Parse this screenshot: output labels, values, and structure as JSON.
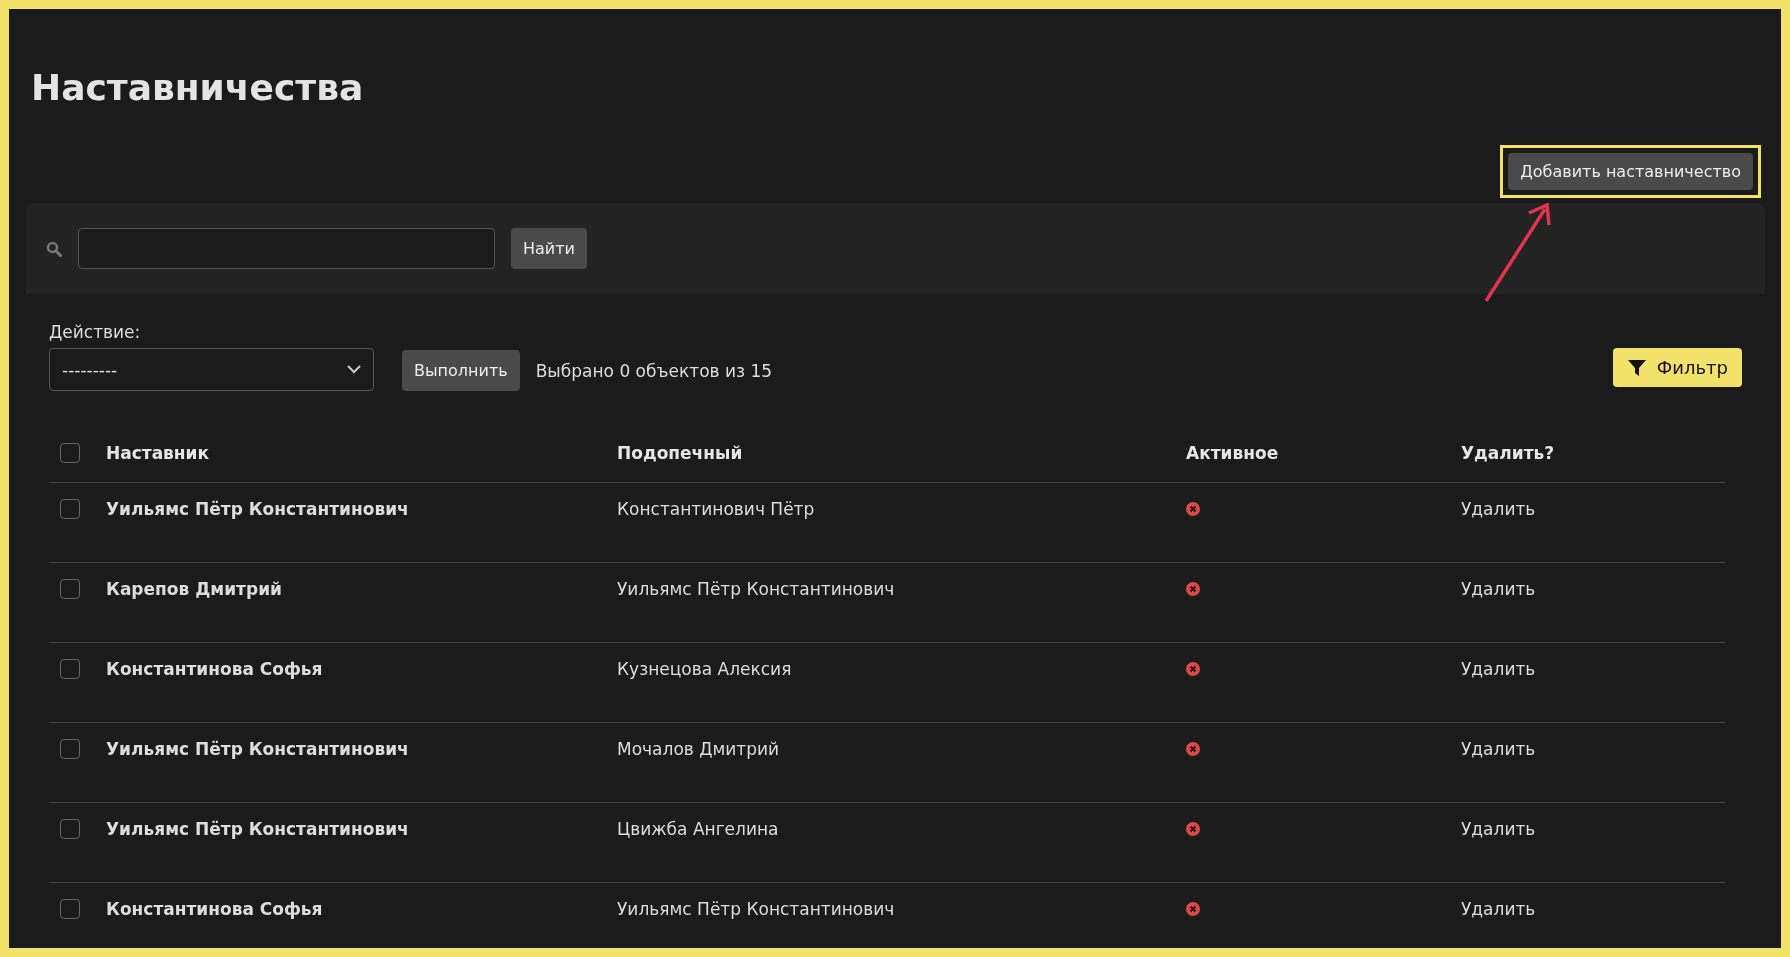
{
  "page": {
    "title": "Наставничества"
  },
  "add_button": {
    "label": "Добавить наставничество",
    "highlighted": true
  },
  "search": {
    "button": "Найти"
  },
  "action": {
    "label": "Действие:",
    "value": "---------",
    "run_button": "Выполнить",
    "selection_count": "Выбрано 0 объектов из 15"
  },
  "filter_button": {
    "label": "Фильтр"
  },
  "table": {
    "select_all_checked": false,
    "columns": [
      "Наставник",
      "Подопечный",
      "Активное",
      "Удалить?"
    ],
    "rows": [
      {
        "checked": false,
        "mentor": "Уильямс Пётр Константинович",
        "mentee": "Константинович Пётр",
        "active": false,
        "delete": "Удалить"
      },
      {
        "checked": false,
        "mentor": "Карепов Дмитрий",
        "mentee": "Уильямс Пётр Константинович",
        "active": false,
        "delete": "Удалить"
      },
      {
        "checked": false,
        "mentor": "Константинова Софья",
        "mentee": "Кузнецова Алексия",
        "active": false,
        "delete": "Удалить"
      },
      {
        "checked": false,
        "mentor": "Уильямс Пётр Константинович",
        "mentee": "Мочалов Дмитрий",
        "active": false,
        "delete": "Удалить"
      },
      {
        "checked": false,
        "mentor": "Уильямс Пётр Константинович",
        "mentee": "Цвижба Ангелина",
        "active": false,
        "delete": "Удалить"
      },
      {
        "checked": false,
        "mentor": "Константинова Софья",
        "mentee": "Уильямс Пётр Константинович",
        "active": false,
        "delete": "Удалить"
      }
    ]
  }
}
